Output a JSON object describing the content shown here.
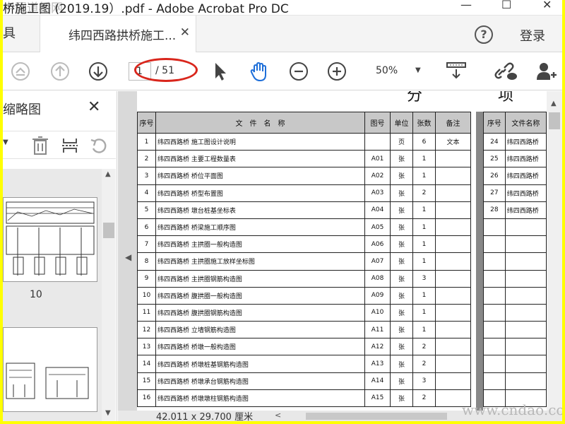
{
  "window": {
    "title": "桥施工图 (2019.19）.pdf - Adobe Acrobat Pro DC",
    "watermark_top": "中国道桥网",
    "minimize": "—",
    "maximize": "☐",
    "close": "✕"
  },
  "tabs": {
    "tools_label": "具",
    "doc_label": "纬四西路拱桥施工...",
    "doc_close": "✕",
    "help": "?",
    "login": "登录"
  },
  "toolbar": {
    "page_current": "1",
    "page_total": "/ 51",
    "zoom": "50%"
  },
  "thumbnails": {
    "title": "页面缩略图",
    "close": "✕",
    "page_number": "10"
  },
  "document": {
    "heading": "分 项 目",
    "columns": [
      "序号",
      "文　件　名　称",
      "图号",
      "单位",
      "张数",
      "备注"
    ],
    "right_columns": [
      "序号",
      "文件名称"
    ],
    "rows": [
      {
        "no": "1",
        "name": "纬四西路桥  施工图设计说明",
        "code": "",
        "unit": "页",
        "count": "6",
        "note": "文本"
      },
      {
        "no": "2",
        "name": "纬四西路桥  主要工程数量表",
        "code": "A01",
        "unit": "张",
        "count": "1",
        "note": ""
      },
      {
        "no": "3",
        "name": "纬四西路桥  桥位平面图",
        "code": "A02",
        "unit": "张",
        "count": "1",
        "note": ""
      },
      {
        "no": "4",
        "name": "纬四西路桥  桥型布置图",
        "code": "A03",
        "unit": "张",
        "count": "2",
        "note": ""
      },
      {
        "no": "5",
        "name": "纬四西路桥  墩台桩基坐标表",
        "code": "A04",
        "unit": "张",
        "count": "1",
        "note": ""
      },
      {
        "no": "6",
        "name": "纬四西路桥  桥梁施工顺序图",
        "code": "A05",
        "unit": "张",
        "count": "1",
        "note": ""
      },
      {
        "no": "7",
        "name": "纬四西路桥  主拱圈一般构造图",
        "code": "A06",
        "unit": "张",
        "count": "1",
        "note": ""
      },
      {
        "no": "8",
        "name": "纬四西路桥  主拱圈施工放样坐标图",
        "code": "A07",
        "unit": "张",
        "count": "1",
        "note": ""
      },
      {
        "no": "9",
        "name": "纬四西路桥  主拱圈钢筋构造图",
        "code": "A08",
        "unit": "张",
        "count": "3",
        "note": ""
      },
      {
        "no": "10",
        "name": "纬四西路桥  腹拱圈一般构造图",
        "code": "A09",
        "unit": "张",
        "count": "1",
        "note": ""
      },
      {
        "no": "11",
        "name": "纬四西路桥  腹拱圈钢筋构造图",
        "code": "A10",
        "unit": "张",
        "count": "1",
        "note": ""
      },
      {
        "no": "12",
        "name": "纬四西路桥  立墙钢筋构造图",
        "code": "A11",
        "unit": "张",
        "count": "1",
        "note": ""
      },
      {
        "no": "13",
        "name": "纬四西路桥  桥墩一般构造图",
        "code": "A12",
        "unit": "张",
        "count": "2",
        "note": ""
      },
      {
        "no": "14",
        "name": "纬四西路桥  桥墩桩基钢筋构造图",
        "code": "A13",
        "unit": "张",
        "count": "2",
        "note": ""
      },
      {
        "no": "15",
        "name": "纬四西路桥  桥墩承台钢筋构造图",
        "code": "A14",
        "unit": "张",
        "count": "3",
        "note": ""
      },
      {
        "no": "16",
        "name": "纬四西路桥  桥墩墩柱钢筋构造图",
        "code": "A15",
        "unit": "张",
        "count": "2",
        "note": ""
      }
    ],
    "right_rows": [
      {
        "no": "24",
        "name": "纬四西路桥"
      },
      {
        "no": "25",
        "name": "纬四西路桥"
      },
      {
        "no": "26",
        "name": "纬四西路桥"
      },
      {
        "no": "27",
        "name": "纬四西路桥"
      },
      {
        "no": "28",
        "name": "纬四西路桥"
      }
    ],
    "page_size": "42.011 x 29.700 厘米"
  },
  "watermark": "www.cndao.com",
  "colors": {
    "annotation_red": "#d9261c",
    "hand_tool_blue": "#1e6fd9",
    "border_yellow": "#ffff00"
  }
}
